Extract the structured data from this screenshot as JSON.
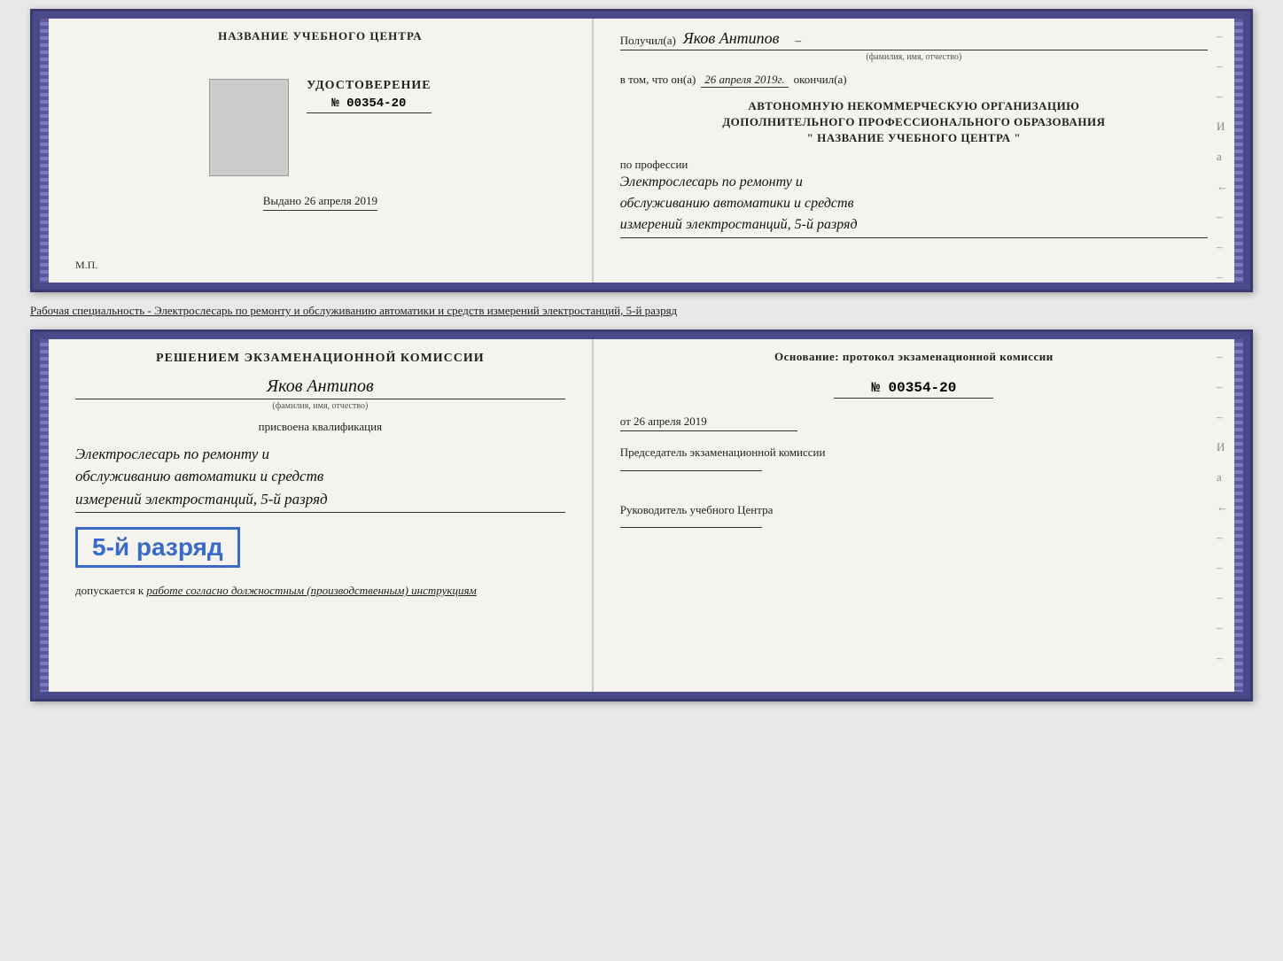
{
  "topBook": {
    "leftPage": {
      "centerTitle": "НАЗВАНИЕ УЧЕБНОГО ЦЕНТРА",
      "udostTitle": "УДОСТОВЕРЕНИЕ",
      "udostNumber": "№ 00354-20",
      "vydanoLabel": "Выдано",
      "vydanoDate": "26 апреля 2019",
      "mpLabel": "М.П."
    },
    "rightPage": {
      "recipientLabel": "Получил(а)",
      "recipientName": "Яков Антипов",
      "fioHint": "(фамилия, имя, отчество)",
      "vtomLabel": "в том, что он(а)",
      "vtomDate": "26 апреля 2019г.",
      "okonchilLabel": "окончил(а)",
      "orgLine1": "АВТОНОМНУЮ НЕКОММЕРЧЕСКУЮ ОРГАНИЗАЦИЮ",
      "orgLine2": "ДОПОЛНИТЕЛЬНОГО ПРОФЕССИОНАЛЬНОГО ОБРАЗОВАНИЯ",
      "orgLine3": "\"  НАЗВАНИЕ УЧЕБНОГО ЦЕНТРА  \"",
      "professionLabel": "по профессии",
      "professionLine1": "Электрослесарь по ремонту и",
      "professionLine2": "обслуживанию автоматики и средств",
      "professionLine3": "измерений электростанций, 5-й разряд"
    }
  },
  "separatorText": "Рабочая специальность - Электрослесарь по ремонту и обслуживанию автоматики и средств измерений электростанций, 5-й разряд",
  "bottomBook": {
    "leftPage": {
      "commissionTitle": "Решением экзаменационной комиссии",
      "personName": "Яков Антипов",
      "fioHint": "(фамилия, имя, отчество)",
      "prisvoenaLabel": "присвоена квалификация",
      "qualLine1": "Электрослесарь по ремонту и",
      "qualLine2": "обслуживанию автоматики и средств",
      "qualLine3": "измерений электростанций, 5-й разряд",
      "razryadBadge": "5-й разряд",
      "dopuskaetsyaLabel": "допускается к",
      "dopuskaetsyaText": "работе согласно должностным (производственным) инструкциям"
    },
    "rightPage": {
      "osnovaniеTitle": "Основание: протокол экзаменационной комиссии",
      "protocolNumber": "№  00354-20",
      "otLabel": "от",
      "otDate": "26 апреля 2019",
      "chairmanLabel": "Председатель экзаменационной комиссии",
      "rukovoditelLabel": "Руководитель учебного Центра"
    }
  }
}
